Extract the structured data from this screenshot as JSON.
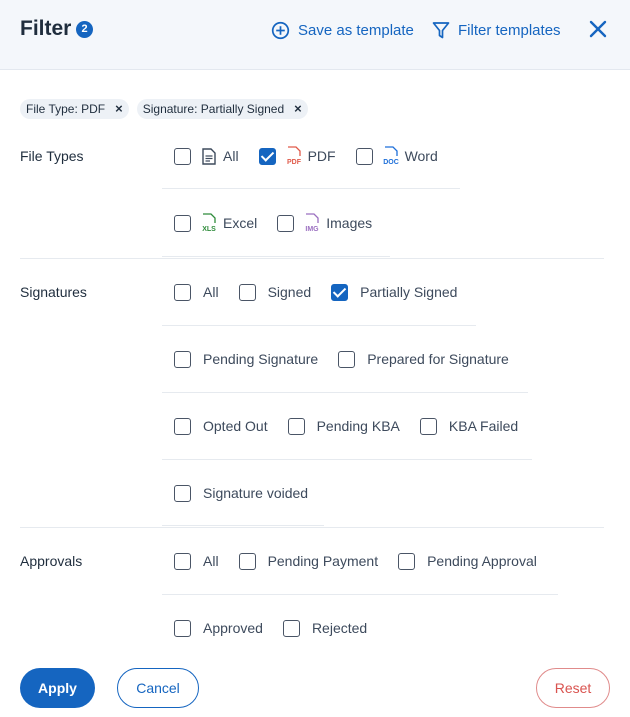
{
  "header": {
    "title": "Filter",
    "count": "2",
    "save_template": "Save as template",
    "filter_templates": "Filter templates"
  },
  "chips": [
    {
      "label": "File Type: PDF"
    },
    {
      "label": "Signature: Partially Signed"
    }
  ],
  "file_types": {
    "label": "File Types",
    "options": [
      {
        "label": "All",
        "checked": false,
        "icon": "document-icon"
      },
      {
        "label": "PDF",
        "checked": true,
        "icon": "pdf-file-icon"
      },
      {
        "label": "Word",
        "checked": false,
        "icon": "doc-file-icon"
      },
      {
        "label": "Excel",
        "checked": false,
        "icon": "xls-file-icon"
      },
      {
        "label": "Images",
        "checked": false,
        "icon": "img-file-icon"
      }
    ],
    "icon_text": {
      "pdf": "PDF",
      "doc": "DOC",
      "xls": "XLS",
      "img": "IMG"
    }
  },
  "signatures": {
    "label": "Signatures",
    "options": [
      {
        "label": "All",
        "checked": false
      },
      {
        "label": "Signed",
        "checked": false
      },
      {
        "label": "Partially Signed",
        "checked": true
      },
      {
        "label": "Pending Signature",
        "checked": false
      },
      {
        "label": "Prepared for Signature",
        "checked": false
      },
      {
        "label": "Opted Out",
        "checked": false
      },
      {
        "label": "Pending KBA",
        "checked": false
      },
      {
        "label": "KBA Failed",
        "checked": false
      },
      {
        "label": "Signature voided",
        "checked": false
      }
    ]
  },
  "approvals": {
    "label": "Approvals",
    "options": [
      {
        "label": "All",
        "checked": false
      },
      {
        "label": "Pending Payment",
        "checked": false
      },
      {
        "label": "Pending Approval",
        "checked": false
      },
      {
        "label": "Approved",
        "checked": false
      },
      {
        "label": "Rejected",
        "checked": false
      }
    ]
  },
  "footer": {
    "apply": "Apply",
    "cancel": "Cancel",
    "reset": "Reset"
  },
  "colors": {
    "primary": "#1565c0",
    "pdf": "#e05a4a",
    "word": "#1e6fd9",
    "excel": "#2e8b3a",
    "image": "#9b6fc0",
    "reset": "#d9534f"
  }
}
